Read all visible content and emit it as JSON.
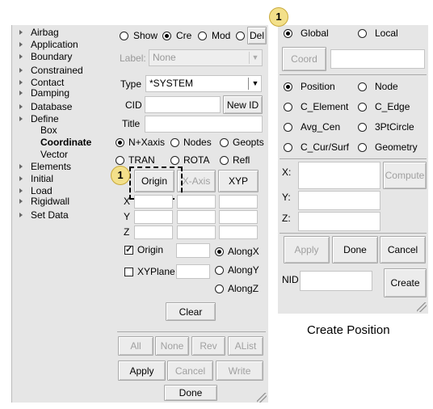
{
  "tree": {
    "items": [
      {
        "label": "Airbag"
      },
      {
        "label": "Application"
      },
      {
        "label": "Boundary"
      },
      {
        "label": "Constrained"
      },
      {
        "label": "Contact"
      },
      {
        "label": "Damping"
      },
      {
        "label": "Database"
      },
      {
        "label": "Define"
      },
      {
        "label": "Box"
      },
      {
        "label": "Coordinate"
      },
      {
        "label": "Vector"
      },
      {
        "label": "Elements"
      },
      {
        "label": "Initial"
      },
      {
        "label": "Load"
      },
      {
        "label": "Rigidwall"
      },
      {
        "label": "Set Data"
      }
    ]
  },
  "mid": {
    "mode_show": "Show",
    "mode_cre": "Cre",
    "mode_mod": "Mod",
    "mode_del": "Del",
    "label_label": "Label:",
    "label_value": "None",
    "type_label": "Type",
    "type_value": "*SYSTEM",
    "cid_label": "CID",
    "cid_value": "",
    "new_id": "New ID",
    "title_label": "Title",
    "title_value": "",
    "opt_nx": "N+Xaxis",
    "opt_nodes": "Nodes",
    "opt_geopts": "Geopts",
    "opt_tran": "TRAN",
    "opt_rota": "ROTA",
    "opt_refl": "Refl",
    "btn_origin": "Origin",
    "btn_xaxis": "X-Axis",
    "btn_xyp": "XYP",
    "x": "X",
    "y": "Y",
    "z": "Z",
    "origin_chk": "Origin",
    "xyplane_chk": "XYPlane",
    "along_x": "AlongX",
    "along_y": "AlongY",
    "along_z": "AlongZ",
    "clear": "Clear",
    "all": "All",
    "none": "None",
    "rev": "Rev",
    "alist": "AList",
    "apply": "Apply",
    "cancel": "Cancel",
    "write": "Write",
    "done": "Done"
  },
  "right": {
    "global": "Global",
    "local": "Local",
    "coord": "Coord",
    "position": "Position",
    "node": "Node",
    "c_element": "C_Element",
    "c_edge": "C_Edge",
    "avg_cen": "Avg_Cen",
    "pt3circle": "3PtCircle",
    "c_cur_surf": "C_Cur/Surf",
    "geometry": "Geometry",
    "x": "X:",
    "y": "Y:",
    "z": "Z:",
    "compute": "Compute",
    "apply": "Apply",
    "done": "Done",
    "cancel": "Cancel",
    "nid": "NID",
    "create": "Create",
    "caption": "Create Position"
  },
  "callouts": {
    "one": "1",
    "two": "1"
  }
}
